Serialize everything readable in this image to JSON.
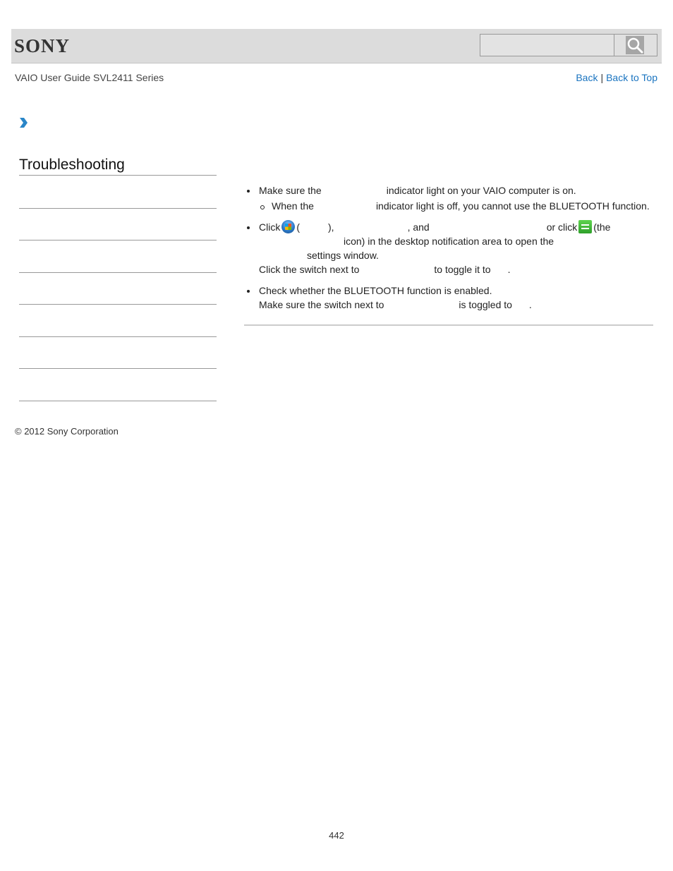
{
  "header": {
    "logo": "SONY",
    "search": {
      "value": "",
      "placeholder": ""
    },
    "search_icon": "magnifier-icon"
  },
  "subheader": {
    "guide_title": "VAIO User Guide SVL2411 Series",
    "links": {
      "back": "Back",
      "separator": "|",
      "back_to_top": "Back to Top"
    }
  },
  "breadcrumb": {
    "icon": "chevron-right-icon"
  },
  "sidebar": {
    "title": "Troubleshooting",
    "items": [
      "",
      "",
      "",
      "",
      "",
      "",
      ""
    ]
  },
  "content": {
    "items": [
      {
        "text_a": "Make sure the",
        "text_b": "indicator light on your VAIO computer is on.",
        "sub": [
          {
            "text_a": "When the",
            "text_b": "indicator light is off, you cannot use the BLUETOOTH function."
          }
        ]
      },
      {
        "line1_a": "Click",
        "line1_b": "(",
        "line1_c": "),",
        "line1_d": ", and",
        "line1_e": "or click",
        "line1_f": "(the",
        "line2": "icon) in the desktop notification area to open the",
        "line3": "settings window.",
        "line4_a": "Click the switch next to",
        "line4_b": "to toggle it to",
        "line4_c": "."
      },
      {
        "line1": "Check whether the BLUETOOTH function is enabled.",
        "line2_a": "Make sure the switch next to",
        "line2_b": "is toggled to",
        "line2_c": "."
      }
    ],
    "icons": {
      "start": "windows-start-icon",
      "charm": "charm-settings-icon"
    }
  },
  "footer": {
    "copyright": "© 2012 Sony Corporation",
    "page_number": "442"
  }
}
